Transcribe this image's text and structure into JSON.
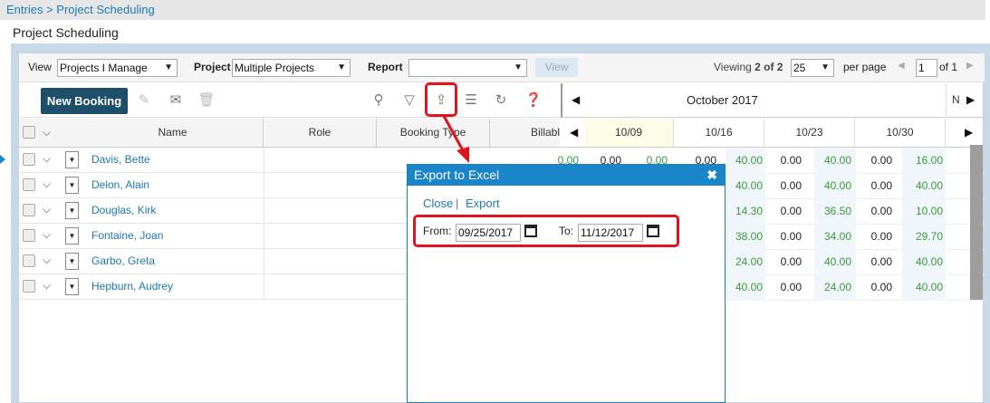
{
  "breadcrumb": "Entries > Project Scheduling",
  "page_title": "Project Scheduling",
  "viewbar": {
    "view_label": "View",
    "view_value": "Projects I Manage",
    "project_label": "Project",
    "project_value": "Multiple Projects",
    "report_label": "Report",
    "report_value": "",
    "view_button": "View",
    "viewing_prefix": "Viewing ",
    "viewing_count": "2 of 2",
    "per_page_value": "25",
    "per_page_label": "per page",
    "page_value": "1",
    "of_pages": "of 1"
  },
  "toolbar": {
    "new_booking": "New Booking"
  },
  "columns": {
    "name": "Name",
    "role": "Role",
    "booking_type": "Booking Type",
    "billable": "Billabl"
  },
  "schedule": {
    "month": "October 2017",
    "next_label": "N",
    "weeks": [
      "10/09",
      "10/16",
      "10/23",
      "10/30"
    ]
  },
  "rows": [
    {
      "name": "Davis, Bette",
      "pre": [
        "0.00",
        "0.00",
        "0.00",
        "0.00"
      ],
      "w16": "40.00",
      "a23": "0.00",
      "w23": "40.00",
      "a30": "0.00",
      "w30": "16.00"
    },
    {
      "name": "Delon, Alain",
      "w16": "40.00",
      "a23": "0.00",
      "w23": "40.00",
      "a30": "0.00",
      "w30": "40.00"
    },
    {
      "name": "Douglas, Kirk",
      "w16": "14.30",
      "a23": "0.00",
      "w23": "36.50",
      "a30": "0.00",
      "w30": "10.00"
    },
    {
      "name": "Fontaine, Joan",
      "w16": "38.00",
      "a23": "0.00",
      "w23": "34.00",
      "a30": "0.00",
      "w30": "29.70"
    },
    {
      "name": "Garbo, Greta",
      "w16": "24.00",
      "a23": "0.00",
      "w23": "40.00",
      "a30": "0.00",
      "w30": "40.00"
    },
    {
      "name": "Hepburn, Audrey",
      "w16": "40.00",
      "a23": "0.00",
      "w23": "24.00",
      "a30": "0.00",
      "w30": "40.00"
    }
  ],
  "modal": {
    "title": "Export to Excel",
    "close_link": "Close",
    "separator": "|",
    "export_link": "Export",
    "from_label": "From:",
    "from_value": "09/25/2017",
    "to_label": "To:",
    "to_value": "11/12/2017"
  },
  "colors": {
    "accent": "#1a85c8",
    "highlight": "#e0141e",
    "primary_button": "#1d4e6a",
    "green_value": "#3a9a3a"
  }
}
